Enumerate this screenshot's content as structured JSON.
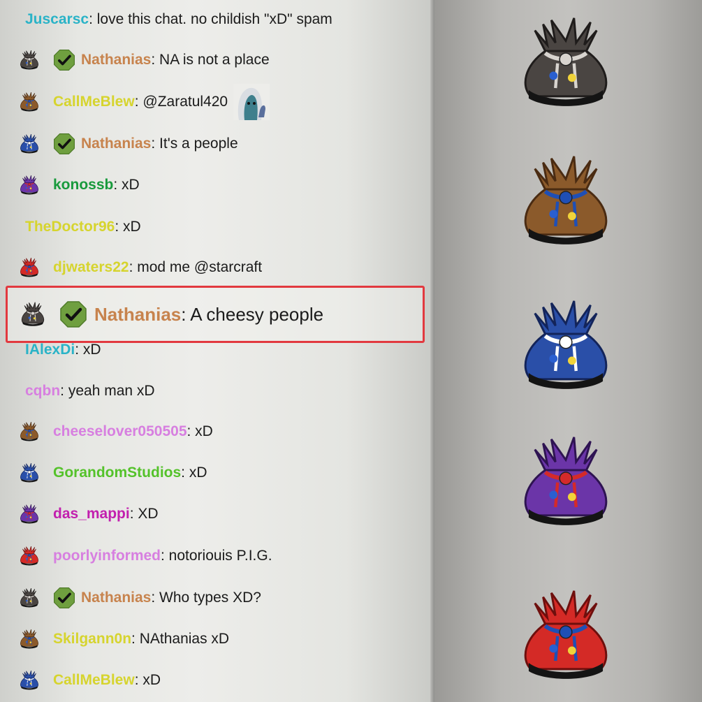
{
  "colors": {
    "highlight_border": "#e2393f",
    "mod_badge": "#6f9f3f",
    "bag_black": "#3a3634",
    "bag_brown": "#7a4a22",
    "bag_blue": "#1f3f8f",
    "bag_purple": "#5a2a8f",
    "bag_red": "#c42421"
  },
  "chat": {
    "messages": [
      {
        "user": "Juscarsc",
        "color": "#2ab3c7",
        "text": ": love this chat. no childish \"xD\" spam",
        "badge": "none",
        "mod": false
      },
      {
        "user": "Nathanias",
        "color": "#c7834d",
        "text": ": NA is not a place",
        "badge": "bag-black-icon",
        "mod": true
      },
      {
        "user": "CallMeBlew",
        "color": "#d6d42e",
        "text": ": @Zaratul420",
        "badge": "bag-brown-icon",
        "mod": false,
        "emote": "emote-icon"
      },
      {
        "user": "Nathanias",
        "color": "#c7834d",
        "text": ": It's a people",
        "badge": "bag-blue-icon",
        "mod": true
      },
      {
        "user": "konossb",
        "color": "#189a3c",
        "text": ": xD",
        "badge": "bag-purple-icon",
        "mod": false
      },
      {
        "user": "TheDoctor96",
        "color": "#d6d42e",
        "text": ": xD",
        "badge": "none",
        "mod": false
      },
      {
        "user": "djwaters22",
        "color": "#d6d42e",
        "text": ": mod me @starcraft",
        "badge": "bag-red-icon",
        "mod": false
      },
      {
        "user": "IAlexDi",
        "color": "#2ab3c7",
        "text": ": xD",
        "badge": "none",
        "mod": false
      },
      {
        "user": "cqbn",
        "color": "#d77fe0",
        "text": ": yeah man xD",
        "badge": "none",
        "mod": false
      },
      {
        "user": "cheeselover050505",
        "color": "#d77fe0",
        "text": ": xD",
        "badge": "bag-brown-icon",
        "mod": false
      },
      {
        "user": "GorandomStudios",
        "color": "#54c22a",
        "text": ": xD",
        "badge": "bag-blue-icon",
        "mod": false
      },
      {
        "user": "das_mappi",
        "color": "#c21fae",
        "text": ": XD",
        "badge": "bag-purple-icon",
        "mod": false
      },
      {
        "user": "poorlyinformed",
        "color": "#d77fe0",
        "text": ": notoriouis P.I.G.",
        "badge": "bag-red-icon",
        "mod": false
      },
      {
        "user": "Nathanias",
        "color": "#c7834d",
        "text": ": Who types XD?",
        "badge": "bag-black-icon",
        "mod": true
      },
      {
        "user": "Skilgann0n",
        "color": "#d6d42e",
        "text": ": NAthanias xD",
        "badge": "bag-brown-icon",
        "mod": false
      },
      {
        "user": "CallMeBlew",
        "color": "#d6d42e",
        "text": ": xD",
        "badge": "bag-blue-icon",
        "mod": false
      }
    ],
    "highlighted": {
      "user": "Nathanias",
      "color": "#c7834d",
      "text": ": A cheesy people",
      "badge": "bag-black-icon",
      "mod": true
    }
  },
  "badge_panel": {
    "bags": [
      "bag-black-icon",
      "bag-brown-icon",
      "bag-blue-icon",
      "bag-purple-icon",
      "bag-red-icon"
    ]
  }
}
